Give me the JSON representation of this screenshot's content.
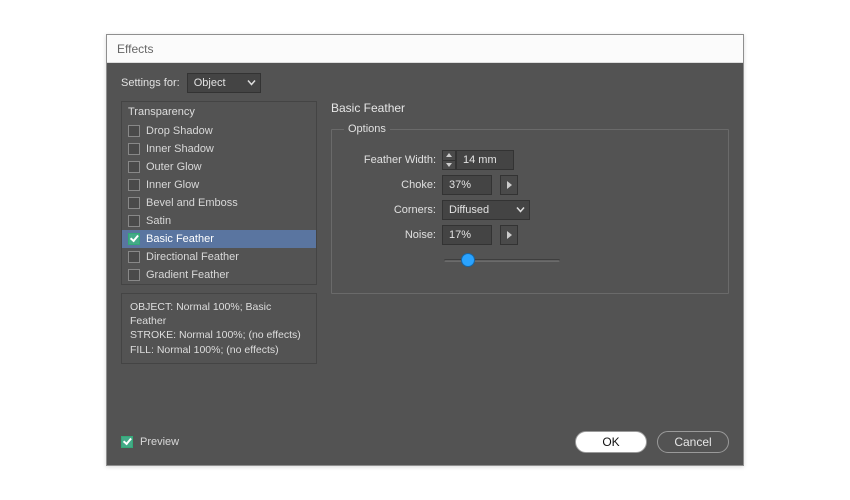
{
  "title": "Effects",
  "settings_for_label": "Settings for:",
  "settings_for_value": "Object",
  "effects_header": "Transparency",
  "effects": [
    {
      "label": "Drop Shadow",
      "checked": false,
      "selected": false
    },
    {
      "label": "Inner Shadow",
      "checked": false,
      "selected": false
    },
    {
      "label": "Outer Glow",
      "checked": false,
      "selected": false
    },
    {
      "label": "Inner Glow",
      "checked": false,
      "selected": false
    },
    {
      "label": "Bevel and Emboss",
      "checked": false,
      "selected": false
    },
    {
      "label": "Satin",
      "checked": false,
      "selected": false
    },
    {
      "label": "Basic Feather",
      "checked": true,
      "selected": true
    },
    {
      "label": "Directional Feather",
      "checked": false,
      "selected": false
    },
    {
      "label": "Gradient Feather",
      "checked": false,
      "selected": false
    }
  ],
  "summary": {
    "line1": "OBJECT: Normal 100%; Basic Feather",
    "line2": "STROKE: Normal 100%; (no effects)",
    "line3": "FILL: Normal 100%; (no effects)"
  },
  "panel_title": "Basic Feather",
  "options_legend": "Options",
  "options": {
    "feather_width": {
      "label": "Feather Width:",
      "value": "14 mm"
    },
    "choke": {
      "label": "Choke:",
      "value": "37%"
    },
    "corners": {
      "label": "Corners:",
      "value": "Diffused"
    },
    "noise": {
      "label": "Noise:",
      "value": "17%",
      "slider_pct": 17
    }
  },
  "preview": {
    "label": "Preview",
    "checked": true
  },
  "buttons": {
    "ok": "OK",
    "cancel": "Cancel"
  }
}
